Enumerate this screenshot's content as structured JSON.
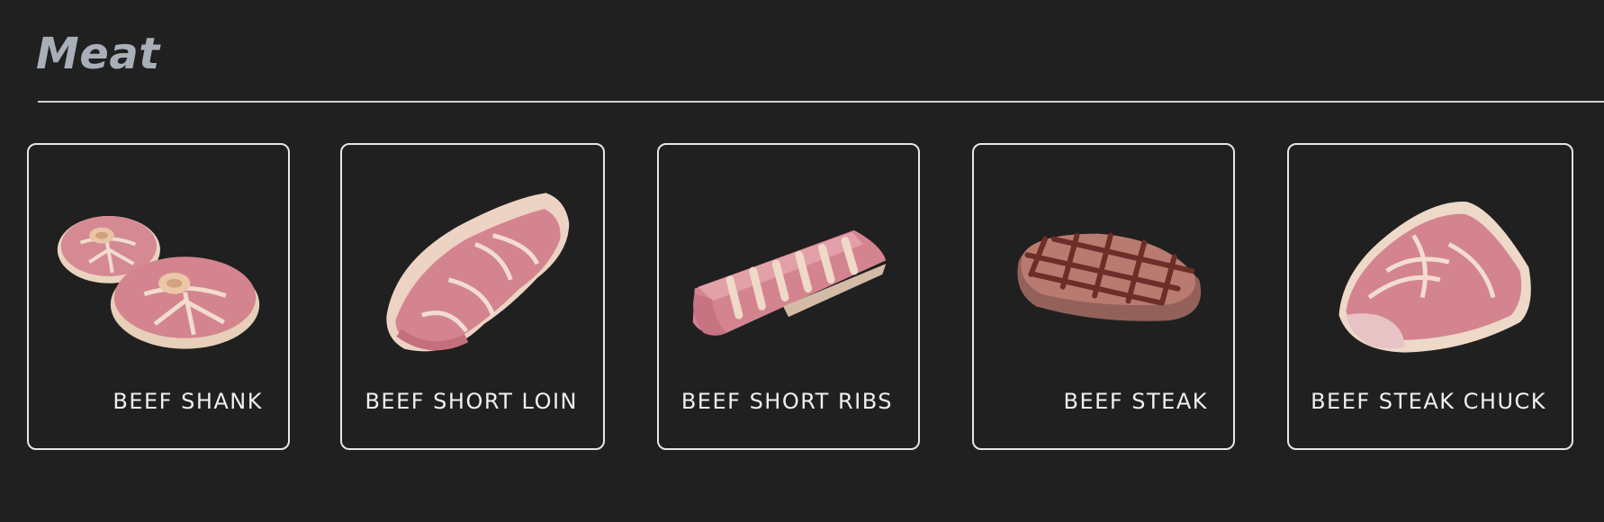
{
  "section": {
    "title": "Meat"
  },
  "products": [
    {
      "name": "BEEF SHANK",
      "icon": "beef-shank-icon"
    },
    {
      "name": "BEEF SHORT LOIN",
      "icon": "beef-short-loin-icon"
    },
    {
      "name": "BEEF SHORT RIBS",
      "icon": "beef-short-ribs-icon"
    },
    {
      "name": "BEEF STEAK",
      "icon": "beef-steak-icon"
    },
    {
      "name": "BEEF STEAK CHUCK",
      "icon": "beef-steak-chuck-icon"
    }
  ],
  "colors": {
    "background": "#202020",
    "title": "#a9afb8",
    "card_border": "#e6e6e6",
    "label": "#f0f0f0",
    "meat_pink": "#d4848f",
    "fat_cream": "#efd9c8",
    "grilled_brown": "#9e6a5c"
  }
}
